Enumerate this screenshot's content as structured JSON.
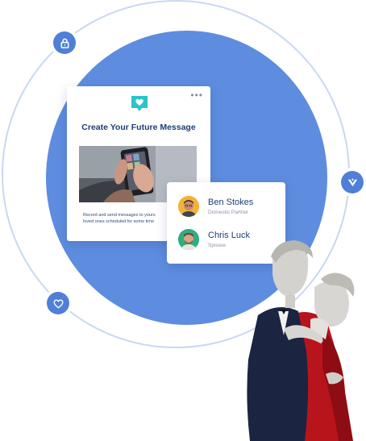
{
  "card": {
    "title": "Create Your Future Message",
    "menu_label": "•••",
    "description_line1": "Record and send messages to yours",
    "description_line2": "loved ones scheduled for some time"
  },
  "contacts": [
    {
      "name": "Ben Stokes",
      "role": "Domestic Partner"
    },
    {
      "name": "Chris Luck",
      "role": "Spouse"
    }
  ],
  "colors": {
    "disc": "#5e8de0",
    "badge": "#4f7fd6",
    "accent": "#2bc4c9",
    "heading": "#1d3f74"
  },
  "icons": [
    "lock-icon",
    "heart-icon",
    "brand-logo-icon",
    "chat-heart-icon"
  ]
}
